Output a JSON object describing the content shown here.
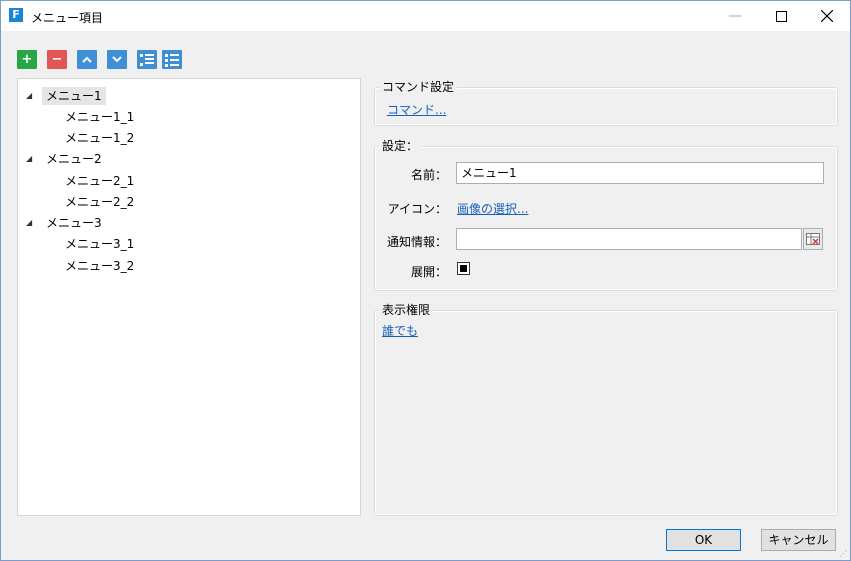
{
  "window": {
    "title": "メニュー項目",
    "app_icon_letter": "F",
    "minimize_glyph": "—",
    "maximize_glyph": "☐",
    "close_glyph": "✕"
  },
  "toolbar": {
    "add_glyph": "+",
    "remove_glyph": "−",
    "up_glyph": "⌃",
    "down_glyph": "⌄"
  },
  "tree": {
    "expand_glyph": "◢",
    "items": [
      {
        "label": "メニュー1",
        "level": 0,
        "expanded": true,
        "selected": true
      },
      {
        "label": "メニュー1_1",
        "level": 1
      },
      {
        "label": "メニュー1_2",
        "level": 1
      },
      {
        "label": "メニュー2",
        "level": 0,
        "expanded": true
      },
      {
        "label": "メニュー2_1",
        "level": 1
      },
      {
        "label": "メニュー2_2",
        "level": 1
      },
      {
        "label": "メニュー3",
        "level": 0,
        "expanded": true
      },
      {
        "label": "メニュー3_1",
        "level": 1
      },
      {
        "label": "メニュー3_2",
        "level": 1
      }
    ]
  },
  "command_group": {
    "title": "コマンド設定",
    "link": "コマンド..."
  },
  "settings_group": {
    "title": "設定：",
    "name_label": "名前：",
    "name_value": "メニュー1",
    "icon_label": "アイコン：",
    "icon_link": "画像の選択...",
    "notify_label": "通知情報：",
    "notify_value": "",
    "expand_label": "展開：",
    "expand_checked": true
  },
  "permission_group": {
    "title": "表示権限",
    "link": "誰でも"
  },
  "footer": {
    "ok_label": "OK",
    "cancel_label": "キャンセル"
  },
  "colors": {
    "add": "#27a745",
    "remove": "#e05555",
    "toolbar_blue": "#3f8fd6",
    "link": "#1a5fbd",
    "accent": "#0078d7"
  }
}
